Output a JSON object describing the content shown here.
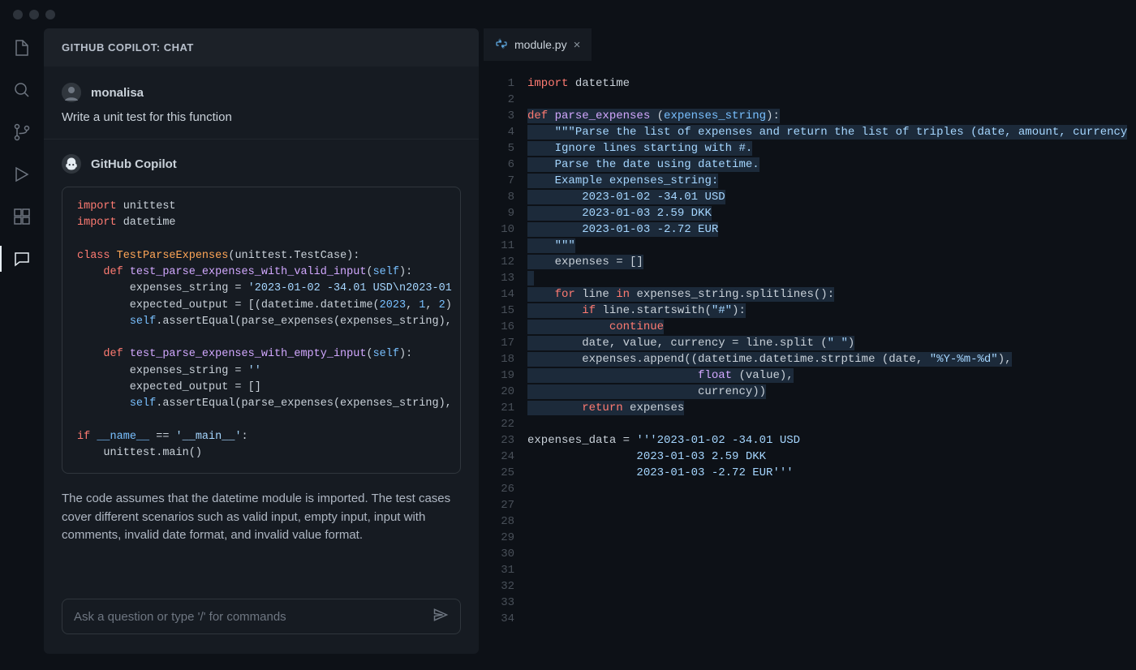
{
  "chat": {
    "header": "GITHUB COPILOT: CHAT",
    "user": {
      "name": "monalisa",
      "message": "Write a unit test for this function"
    },
    "copilot": {
      "name": "GitHub Copilot",
      "description": "The code assumes that the datetime module is imported. The test cases cover different scenarios such as valid input, empty input, input with comments, invalid date format, and invalid value format."
    },
    "input_placeholder": "Ask a question or type '/' for commands"
  },
  "copilot_code": {
    "lines": [
      {
        "t": [
          [
            "kw",
            "import"
          ],
          [
            "",
            " unittest"
          ]
        ]
      },
      {
        "t": [
          [
            "kw",
            "import"
          ],
          [
            "",
            " datetime"
          ]
        ]
      },
      {
        "t": [
          [
            "",
            ""
          ]
        ]
      },
      {
        "t": [
          [
            "kw",
            "class "
          ],
          [
            "cls",
            "TestParseExpenses"
          ],
          [
            "",
            "(unittest.TestCase):"
          ]
        ]
      },
      {
        "t": [
          [
            "",
            "    "
          ],
          [
            "kw",
            "def "
          ],
          [
            "fn",
            "test_parse_expenses_with_valid_input"
          ],
          [
            "",
            "("
          ],
          [
            "self",
            "self"
          ],
          [
            "",
            "):"
          ]
        ]
      },
      {
        "t": [
          [
            "",
            "        expenses_string = "
          ],
          [
            "str",
            "'2023-01-02 -34.01 USD\\n2023-01"
          ]
        ]
      },
      {
        "t": [
          [
            "",
            "        expected_output = [(datetime.datetime("
          ],
          [
            "num",
            "2023"
          ],
          [
            "",
            ", "
          ],
          [
            "num",
            "1"
          ],
          [
            "",
            ", "
          ],
          [
            "num",
            "2"
          ],
          [
            "",
            ")"
          ]
        ]
      },
      {
        "t": [
          [
            "",
            "        "
          ],
          [
            "self",
            "self"
          ],
          [
            "",
            ".assertEqual(parse_expenses(expenses_string),"
          ]
        ]
      },
      {
        "t": [
          [
            "",
            ""
          ]
        ]
      },
      {
        "t": [
          [
            "",
            "    "
          ],
          [
            "kw",
            "def "
          ],
          [
            "fn",
            "test_parse_expenses_with_empty_input"
          ],
          [
            "",
            "("
          ],
          [
            "self",
            "self"
          ],
          [
            "",
            "):"
          ]
        ]
      },
      {
        "t": [
          [
            "",
            "        expenses_string = "
          ],
          [
            "str",
            "''"
          ]
        ]
      },
      {
        "t": [
          [
            "",
            "        expected_output = []"
          ]
        ]
      },
      {
        "t": [
          [
            "",
            "        "
          ],
          [
            "self",
            "self"
          ],
          [
            "",
            ".assertEqual(parse_expenses(expenses_string),"
          ]
        ]
      },
      {
        "t": [
          [
            "",
            ""
          ]
        ]
      },
      {
        "t": [
          [
            "kw",
            "if "
          ],
          [
            "name",
            "__name__"
          ],
          [
            "",
            " == "
          ],
          [
            "str",
            "'__main__'"
          ],
          [
            "",
            ":"
          ]
        ]
      },
      {
        "t": [
          [
            "",
            "    unittest.main()"
          ]
        ]
      }
    ]
  },
  "editor": {
    "tab": {
      "filename": "module.py"
    },
    "line_count": 34,
    "lines": [
      {
        "n": 1,
        "hl": false,
        "t": [
          [
            "kw",
            "import"
          ],
          [
            "",
            " datetime"
          ]
        ]
      },
      {
        "n": 2,
        "hl": false,
        "t": [
          [
            "",
            ""
          ]
        ]
      },
      {
        "n": 3,
        "hl": true,
        "t": [
          [
            "kw",
            "def "
          ],
          [
            "fn",
            "parse_expenses"
          ],
          [
            "",
            " ("
          ],
          [
            "self",
            "expenses_string"
          ],
          [
            "",
            "):"
          ]
        ]
      },
      {
        "n": 4,
        "hl": true,
        "t": [
          [
            "",
            "    "
          ],
          [
            "str",
            "\"\"\"Parse the list of expenses and return the list of triples (date, amount, currency"
          ]
        ]
      },
      {
        "n": 5,
        "hl": true,
        "t": [
          [
            "",
            "    "
          ],
          [
            "str",
            "Ignore lines starting with #."
          ]
        ]
      },
      {
        "n": 6,
        "hl": true,
        "t": [
          [
            "",
            "    "
          ],
          [
            "str",
            "Parse the date using datetime."
          ]
        ]
      },
      {
        "n": 7,
        "hl": true,
        "t": [
          [
            "",
            "    "
          ],
          [
            "str",
            "Example expenses_string:"
          ]
        ]
      },
      {
        "n": 8,
        "hl": true,
        "t": [
          [
            "",
            "        "
          ],
          [
            "str",
            "2023-01-02 -34.01 USD"
          ]
        ]
      },
      {
        "n": 9,
        "hl": true,
        "t": [
          [
            "",
            "        "
          ],
          [
            "str",
            "2023-01-03 2.59 DKK"
          ]
        ]
      },
      {
        "n": 10,
        "hl": true,
        "t": [
          [
            "",
            "        "
          ],
          [
            "str",
            "2023-01-03 -2.72 EUR"
          ]
        ]
      },
      {
        "n": 11,
        "hl": true,
        "t": [
          [
            "",
            "    "
          ],
          [
            "str",
            "\"\"\""
          ]
        ]
      },
      {
        "n": 12,
        "hl": true,
        "t": [
          [
            "",
            "    expenses = []"
          ]
        ]
      },
      {
        "n": 13,
        "hl": true,
        "t": [
          [
            "",
            ""
          ]
        ]
      },
      {
        "n": 14,
        "hl": true,
        "t": [
          [
            "",
            "    "
          ],
          [
            "kw",
            "for"
          ],
          [
            "",
            " line "
          ],
          [
            "kw",
            "in"
          ],
          [
            "",
            " expenses_string.splitlines():"
          ]
        ]
      },
      {
        "n": 15,
        "hl": true,
        "t": [
          [
            "",
            "        "
          ],
          [
            "kw",
            "if"
          ],
          [
            "",
            " line.startswith("
          ],
          [
            "str",
            "\"#\""
          ],
          [
            "",
            "):"
          ]
        ]
      },
      {
        "n": 16,
        "hl": true,
        "t": [
          [
            "",
            "            "
          ],
          [
            "kw",
            "continue"
          ]
        ]
      },
      {
        "n": 17,
        "hl": true,
        "t": [
          [
            "",
            "        date, value, currency = line.split ("
          ],
          [
            "str",
            "\" \""
          ],
          [
            "",
            ")"
          ]
        ]
      },
      {
        "n": 18,
        "hl": true,
        "t": [
          [
            "",
            "        expenses.append((datetime.datetime.strptime (date, "
          ],
          [
            "str",
            "\"%Y-%m-%d\""
          ],
          [
            "",
            "),"
          ]
        ]
      },
      {
        "n": 19,
        "hl": true,
        "t": [
          [
            "",
            "                         "
          ],
          [
            "fn",
            "float"
          ],
          [
            "",
            " (value),"
          ]
        ]
      },
      {
        "n": 20,
        "hl": true,
        "t": [
          [
            "",
            "                         currency))"
          ]
        ]
      },
      {
        "n": 21,
        "hl": true,
        "t": [
          [
            "",
            "        "
          ],
          [
            "kw",
            "return"
          ],
          [
            "",
            " expenses"
          ]
        ]
      },
      {
        "n": 22,
        "hl": false,
        "t": [
          [
            "",
            ""
          ]
        ]
      },
      {
        "n": 23,
        "hl": false,
        "t": [
          [
            "",
            "expenses_data = "
          ],
          [
            "str",
            "'''2023-01-02 -34.01 USD"
          ]
        ]
      },
      {
        "n": 24,
        "hl": false,
        "t": [
          [
            "",
            "                "
          ],
          [
            "str",
            "2023-01-03 2.59 DKK"
          ]
        ]
      },
      {
        "n": 25,
        "hl": false,
        "t": [
          [
            "",
            "                "
          ],
          [
            "str",
            "2023-01-03 -2.72 EUR'''"
          ]
        ]
      },
      {
        "n": 26,
        "hl": false,
        "t": [
          [
            "",
            ""
          ]
        ]
      },
      {
        "n": 27,
        "hl": false,
        "t": [
          [
            "",
            ""
          ]
        ]
      },
      {
        "n": 28,
        "hl": false,
        "t": [
          [
            "",
            ""
          ]
        ]
      },
      {
        "n": 29,
        "hl": false,
        "t": [
          [
            "",
            ""
          ]
        ]
      },
      {
        "n": 30,
        "hl": false,
        "t": [
          [
            "",
            ""
          ]
        ]
      },
      {
        "n": 31,
        "hl": false,
        "t": [
          [
            "",
            ""
          ]
        ]
      },
      {
        "n": 32,
        "hl": false,
        "t": [
          [
            "",
            ""
          ]
        ]
      },
      {
        "n": 33,
        "hl": false,
        "t": [
          [
            "",
            ""
          ]
        ]
      },
      {
        "n": 34,
        "hl": false,
        "t": [
          [
            "",
            ""
          ]
        ]
      }
    ]
  }
}
